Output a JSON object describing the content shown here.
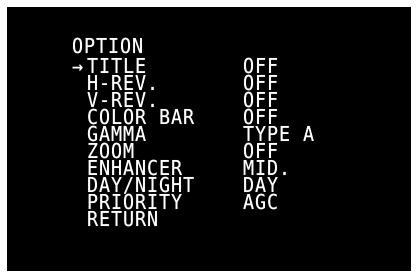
{
  "menu": {
    "title": "OPTION",
    "cursor_glyph": "→",
    "selected_index": 0,
    "items": [
      {
        "label": "TITLE",
        "value": "OFF"
      },
      {
        "label": "H-REV.",
        "value": "OFF"
      },
      {
        "label": "V-REV.",
        "value": "OFF"
      },
      {
        "label": "COLOR BAR",
        "value": "OFF"
      },
      {
        "label": "GAMMA",
        "value": "TYPE A"
      },
      {
        "label": "ZOOM",
        "value": "OFF"
      },
      {
        "label": "ENHANCER",
        "value": "MID."
      },
      {
        "label": "DAY/NIGHT",
        "value": "DAY"
      },
      {
        "label": "PRIORITY",
        "value": "AGC"
      },
      {
        "label": "RETURN",
        "value": ""
      }
    ]
  },
  "colors": {
    "background": "#000000",
    "text": "#ffffff",
    "frame": "#ffffff"
  }
}
